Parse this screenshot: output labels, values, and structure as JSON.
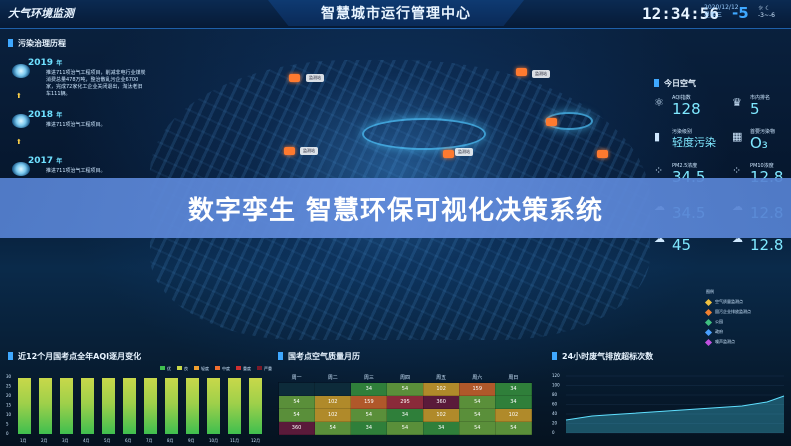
{
  "header": {
    "left_title": "大气环境监测",
    "center_title": "智慧城市运行管理中心",
    "clock": "12:34:56",
    "date": "2020/12/12",
    "weekday": "星期三",
    "temperature": "-5",
    "weather": [
      "晴",
      "-3~-6"
    ]
  },
  "history": {
    "title": "污染治理历程",
    "entries": [
      {
        "year": "2019",
        "suffix": "年",
        "text": "推进711项治气工程项目，削减非电行业煤炭消费总量478万吨，整治散乱污企业6700家，完成72家化工企业关闭退出，淘汰老旧车111辆。"
      },
      {
        "year": "2018",
        "suffix": "年",
        "text": "推进711项治气工程项目。"
      },
      {
        "year": "2017",
        "suffix": "年",
        "text": "推进711项治气工程项目。"
      }
    ]
  },
  "air": {
    "title": "今日空气",
    "items": [
      {
        "label": "AQI指数",
        "value": "128",
        "icon": "molecule-icon"
      },
      {
        "label": "市内排名",
        "value": "5",
        "icon": "trophy-icon"
      },
      {
        "label": "污染级别",
        "value": "轻度污染",
        "icon": "bar-icon"
      },
      {
        "label": "首要污染物",
        "value": "O₃",
        "icon": "factory-icon"
      },
      {
        "label": "PM2.5浓度",
        "value": "34.5",
        "icon": "pm25-icon"
      },
      {
        "label": "PM10浓度",
        "value": "12.8",
        "icon": "pm10-icon"
      },
      {
        "label": "",
        "value": "34.5",
        "icon": "cloud-icon"
      },
      {
        "label": "",
        "value": "12.8",
        "icon": "cloud-icon"
      },
      {
        "label": "",
        "value": "45",
        "icon": "cloud-icon"
      },
      {
        "label": "",
        "value": "12.8",
        "icon": "cloud-icon"
      }
    ]
  },
  "legend": {
    "title": "图例",
    "items": [
      {
        "label": "空气质量监测点",
        "color": "#f0c040"
      },
      {
        "label": "固污企业排放监测点",
        "color": "#f08030"
      },
      {
        "label": "公园",
        "color": "#40c080"
      },
      {
        "label": "政府",
        "color": "#4aa0ff"
      },
      {
        "label": "噪声监测点",
        "color": "#c050e0"
      }
    ]
  },
  "map_tags": [
    "监测站",
    "监测站",
    "监测站",
    "监测站"
  ],
  "banner": "数字孪生 智慧环保可视化决策系统",
  "aqi_chart": {
    "title": "近12个月国考点全年AQI逐月变化",
    "legend": [
      "优",
      "良",
      "轻度",
      "中度",
      "重度",
      "严重"
    ],
    "legend_colors": [
      "#3fbf4f",
      "#c8d84a",
      "#f0a030",
      "#f07030",
      "#d03030",
      "#7a1a2a"
    ],
    "months": [
      "1月",
      "2月",
      "3月",
      "4月",
      "5月",
      "6月",
      "7月",
      "8月",
      "9月",
      "10月",
      "11月",
      "12月"
    ],
    "yticks": [
      "30",
      "25",
      "20",
      "15",
      "10",
      "5",
      "0"
    ]
  },
  "calendar": {
    "title": "国考点空气质量月历",
    "headers": [
      "周一",
      "周二",
      "周三",
      "周四",
      "周五",
      "周六",
      "周日"
    ],
    "rows": [
      [
        "",
        "",
        "34",
        "54",
        "102",
        "159",
        "34"
      ],
      [
        "54",
        "102",
        "159",
        "295",
        "360",
        "54",
        "34"
      ],
      [
        "54",
        "102",
        "54",
        "34",
        "102",
        "54",
        "102"
      ],
      [
        "360",
        "54",
        "34",
        "54",
        "34",
        "54",
        "54"
      ]
    ]
  },
  "line_chart": {
    "title": "24小时废气排放超标次数",
    "yticks": [
      "120",
      "100",
      "80",
      "60",
      "40",
      "20",
      "0"
    ]
  }
}
